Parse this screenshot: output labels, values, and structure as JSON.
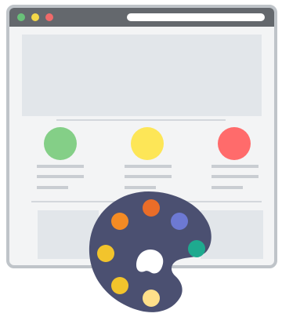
{
  "icons": {
    "browser": "browser-window-icon",
    "palette": "paint-palette-icon"
  },
  "colors": {
    "browser_frame": "#bfc4c9",
    "browser_titlebar": "#64686d",
    "browser_background": "#f3f4f5",
    "content_block": "#e2e6ea",
    "text_line": "#c9cdd2",
    "circle_green": "#84cf87",
    "circle_yellow": "#fde657",
    "circle_red": "#ff6b6b",
    "palette_body": "#4b5071",
    "paint_orange": "#f48b24",
    "paint_dark_orange": "#ea6d28",
    "paint_purple": "#6d79d3",
    "paint_teal": "#1eaa8f",
    "paint_gold": "#f2c42c",
    "paint_light_yellow": "#ffe08a"
  }
}
